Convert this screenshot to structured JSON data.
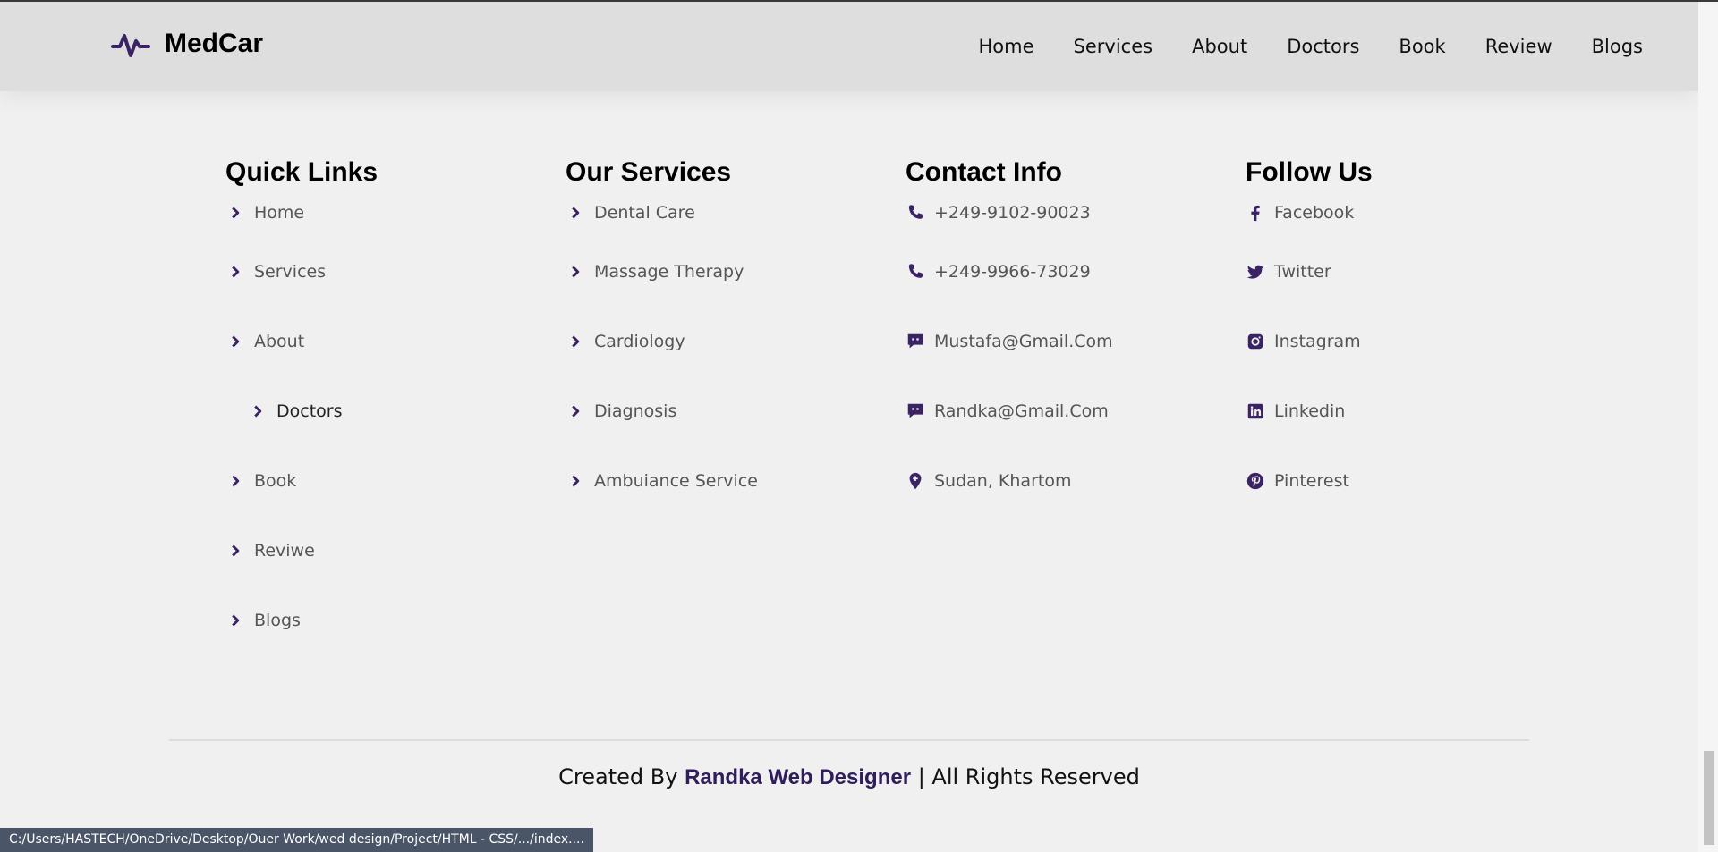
{
  "app": {
    "name": "MedCar"
  },
  "nav": [
    "Home",
    "Services",
    "About",
    "Doctors",
    "Book",
    "Review",
    "Blogs"
  ],
  "footer": {
    "quick_links": {
      "title": "Quick Links",
      "items": [
        "Home",
        "Services",
        "About",
        "Doctors",
        "Book",
        "Reviwe",
        "Blogs"
      ],
      "hovered": "Doctors"
    },
    "services": {
      "title": "Our Services",
      "items": [
        "Dental Care",
        "Massage Therapy",
        "Cardiology",
        "Diagnosis",
        "Ambuiance Service"
      ]
    },
    "contact": {
      "title": "Contact Info",
      "items": [
        {
          "icon": "phone-icon",
          "text": "+249-9102-90023"
        },
        {
          "icon": "phone-icon",
          "text": "+249-9966-73029"
        },
        {
          "icon": "chat-icon",
          "text": "Mustafa@Gmail.Com"
        },
        {
          "icon": "chat-icon",
          "text": "Randka@Gmail.Com"
        },
        {
          "icon": "map-pin-icon",
          "text": "Sudan, Khartom"
        }
      ]
    },
    "follow": {
      "title": "Follow Us",
      "items": [
        {
          "icon": "facebook-icon",
          "text": "Facebook"
        },
        {
          "icon": "twitter-icon",
          "text": "Twitter"
        },
        {
          "icon": "instagram-icon",
          "text": "Instagram"
        },
        {
          "icon": "linkedin-icon",
          "text": "Linkedin"
        },
        {
          "icon": "pinterest-icon",
          "text": "Pinterest"
        }
      ]
    }
  },
  "credit": {
    "prefix": "Created By",
    "author": "Randka Web Designer",
    "suffix": "| All Rights Reserved"
  },
  "status_bar": "C:/Users/HASTECH/OneDrive/Desktop/Ouer Work/wed design/Project/HTML - CSS/.../index....",
  "colors": {
    "accent": "#3a2364",
    "header_bg": "#dedede",
    "page_bg": "#f0f0f0"
  }
}
